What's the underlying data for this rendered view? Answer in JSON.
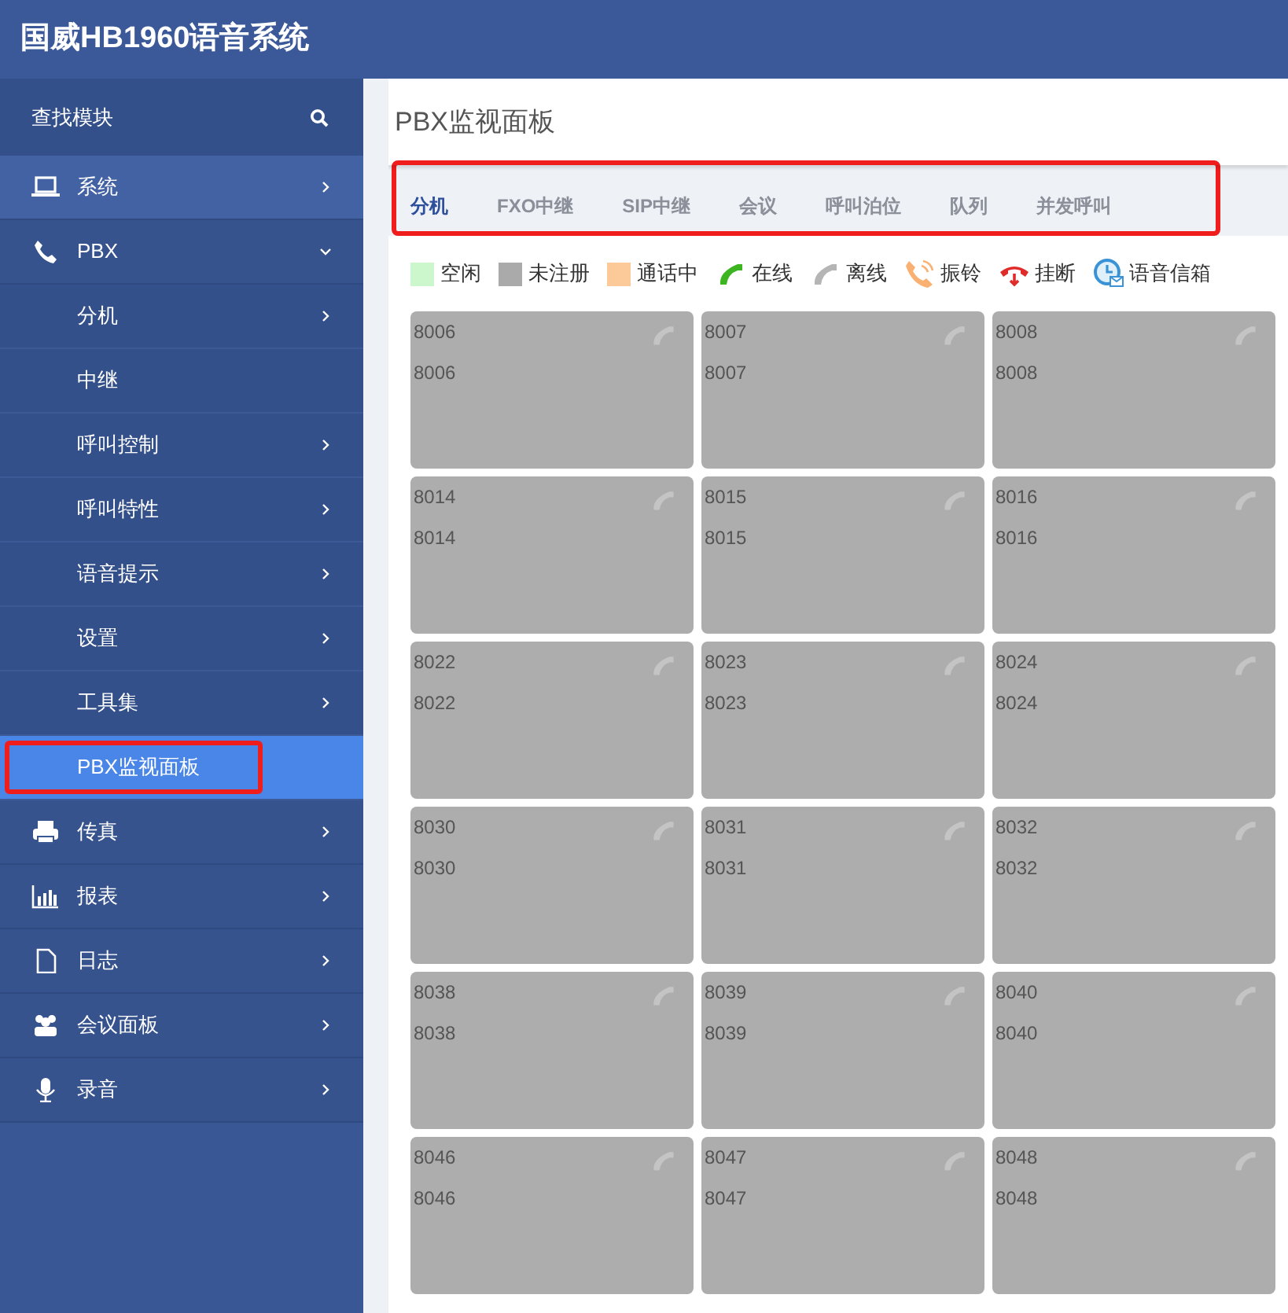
{
  "header": {
    "title": "国威HB1960语音系统"
  },
  "sidebar": {
    "search_label": "查找模块",
    "items": [
      {
        "label": "系统",
        "kind": "laptop",
        "hovered": true,
        "expanded": false,
        "has_arrow": true
      },
      {
        "label": "PBX",
        "kind": "phone",
        "hovered": false,
        "expanded": true,
        "has_arrow": true,
        "children": [
          {
            "label": "分机",
            "selected": false,
            "has_arrow": true,
            "highlighted": false
          },
          {
            "label": "中继",
            "selected": false,
            "has_arrow": false,
            "highlighted": false
          },
          {
            "label": "呼叫控制",
            "selected": false,
            "has_arrow": true,
            "highlighted": false
          },
          {
            "label": "呼叫特性",
            "selected": false,
            "has_arrow": true,
            "highlighted": false
          },
          {
            "label": "语音提示",
            "selected": false,
            "has_arrow": true,
            "highlighted": false
          },
          {
            "label": "设置",
            "selected": false,
            "has_arrow": true,
            "highlighted": false
          },
          {
            "label": "工具集",
            "selected": false,
            "has_arrow": true,
            "highlighted": false
          },
          {
            "label": "PBX监视面板",
            "selected": true,
            "has_arrow": false,
            "highlighted": true
          }
        ]
      },
      {
        "label": "传真",
        "kind": "printer",
        "hovered": false,
        "expanded": false,
        "has_arrow": true
      },
      {
        "label": "报表",
        "kind": "chart",
        "hovered": false,
        "expanded": false,
        "has_arrow": true
      },
      {
        "label": "日志",
        "kind": "file",
        "hovered": false,
        "expanded": false,
        "has_arrow": true
      },
      {
        "label": "会议面板",
        "kind": "users",
        "hovered": false,
        "expanded": false,
        "has_arrow": true
      },
      {
        "label": "录音",
        "kind": "mic",
        "hovered": false,
        "expanded": false,
        "has_arrow": true
      }
    ]
  },
  "page": {
    "title": "PBX监视面板"
  },
  "tabs_highlighted": true,
  "tabs": [
    {
      "label": "分机",
      "selected": true
    },
    {
      "label": "FXO中继",
      "selected": false
    },
    {
      "label": "SIP中继",
      "selected": false
    },
    {
      "label": "会议",
      "selected": false
    },
    {
      "label": "呼叫泊位",
      "selected": false
    },
    {
      "label": "队列",
      "selected": false
    },
    {
      "label": "并发呼叫",
      "selected": false
    }
  ],
  "legend": [
    {
      "kind": "swatch",
      "label": "空闲",
      "color": "#ccf7cc"
    },
    {
      "kind": "swatch",
      "label": "未注册",
      "color": "#aaaaaa"
    },
    {
      "kind": "swatch",
      "label": "通话中",
      "color": "#fcc998"
    },
    {
      "kind": "online",
      "label": "在线"
    },
    {
      "kind": "offline",
      "label": "离线"
    },
    {
      "kind": "ringing",
      "label": "振铃"
    },
    {
      "kind": "hangup",
      "label": "挂断"
    },
    {
      "kind": "voicemail",
      "label": "语音信箱"
    }
  ],
  "extensions": [
    {
      "number": "8006",
      "name": "8006",
      "color": "#adadad"
    },
    {
      "number": "8007",
      "name": "8007",
      "color": "#adadad"
    },
    {
      "number": "8008",
      "name": "8008",
      "color": "#adadad"
    },
    {
      "number": "8014",
      "name": "8014",
      "color": "#adadad"
    },
    {
      "number": "8015",
      "name": "8015",
      "color": "#adadad"
    },
    {
      "number": "8016",
      "name": "8016",
      "color": "#adadad"
    },
    {
      "number": "8022",
      "name": "8022",
      "color": "#adadad"
    },
    {
      "number": "8023",
      "name": "8023",
      "color": "#adadad"
    },
    {
      "number": "8024",
      "name": "8024",
      "color": "#adadad"
    },
    {
      "number": "8030",
      "name": "8030",
      "color": "#adadad"
    },
    {
      "number": "8031",
      "name": "8031",
      "color": "#adadad"
    },
    {
      "number": "8032",
      "name": "8032",
      "color": "#adadad"
    },
    {
      "number": "8038",
      "name": "8038",
      "color": "#adadad"
    },
    {
      "number": "8039",
      "name": "8039",
      "color": "#adadad"
    },
    {
      "number": "8040",
      "name": "8040",
      "color": "#adadad"
    },
    {
      "number": "8046",
      "name": "8046",
      "color": "#adadad"
    },
    {
      "number": "8047",
      "name": "8047",
      "color": "#adadad"
    },
    {
      "number": "8048",
      "name": "8048",
      "color": "#adadad"
    }
  ]
}
